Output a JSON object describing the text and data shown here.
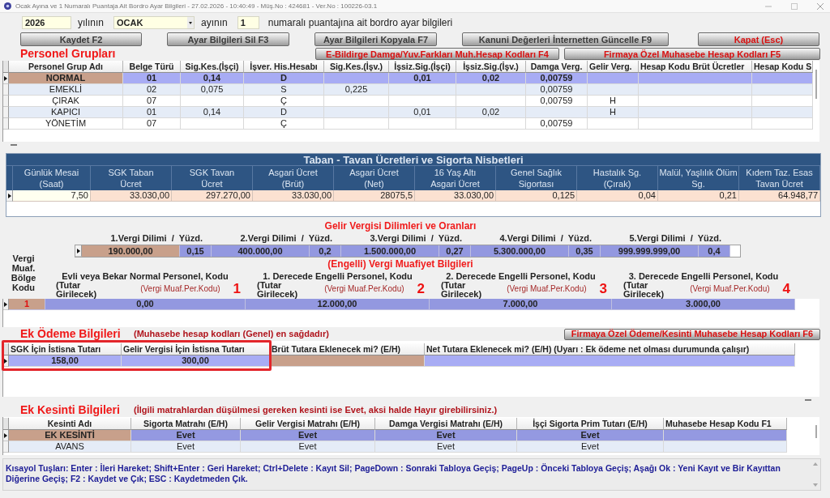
{
  "window": {
    "title": "Ocak Ayına ve 1 Numaralı Puantaja Ait Bordro Ayar Bilgileri - 27.02.2026 - 10:40:49 - Müş.No : 424681 - Ver.No : 100226-03.1"
  },
  "period": {
    "year": "2026",
    "year_label": "yılının",
    "month": "OCAK",
    "month_label": "ayının",
    "payroll_number": "1",
    "caption": "numaralı puantajına ait bordro ayar bilgileri"
  },
  "toolbar": [
    {
      "label": "Kaydet F2",
      "kind": "normal"
    },
    {
      "label": "Ayar Bilgileri Sil F3",
      "kind": "normal"
    },
    {
      "label": "Ayar Bilgileri Kopyala F7",
      "kind": "normal"
    },
    {
      "label": "Kanuni Değerleri İnternetten Güncelle F9",
      "kind": "normal"
    },
    {
      "label": "Kapat (Esc)",
      "kind": "warning"
    }
  ],
  "personel_gruplari": {
    "title": "Personel Grupları",
    "buttons": [
      {
        "label": "E-Bildirge Damga/Yuv.Farkları Muh.Hesap Kodları F4",
        "kind": "warning"
      },
      {
        "label": "Firmaya Özel Muhasebe Hesap Kodları F5",
        "kind": "warning"
      }
    ],
    "columns": [
      {
        "label": "Personel Grup Adı",
        "focused": true
      },
      {
        "label": "Belge Türü",
        "focused": false
      },
      {
        "label": "Sig.Kes.(İşçi)",
        "focused": false
      },
      {
        "label": "İşver. His.Hesabı",
        "focused": false
      },
      {
        "label": "Sig.Kes.(İşv.)",
        "focused": false
      },
      {
        "label": "İşsiz.Sig.(İşçi)",
        "focused": false
      },
      {
        "label": "İşsiz.Sig.(İşv.)",
        "focused": false
      },
      {
        "label": "Damga Verg.",
        "focused": false
      },
      {
        "label": "Gelir Verg.",
        "focused": false
      },
      {
        "label": "Hesap Kodu Brüt Ücretler",
        "focused": false
      },
      {
        "label": "Hesap Kodu S",
        "focused": false
      }
    ],
    "rows": [
      {
        "selected": true,
        "cells": [
          "NORMAL",
          "01",
          "0,14",
          "D",
          null,
          "0,01",
          "0,02",
          "0,00759",
          null,
          null,
          null
        ]
      },
      {
        "selected": false,
        "cells": [
          "EMEKLİ",
          "02",
          "0,075",
          "S",
          "0,225",
          null,
          null,
          "0,00759",
          null,
          null,
          null
        ]
      },
      {
        "selected": false,
        "cells": [
          "ÇIRAK",
          "07",
          null,
          "Ç",
          null,
          null,
          null,
          "0,00759",
          "H",
          null,
          null
        ]
      },
      {
        "selected": false,
        "cells": [
          "KAPICI",
          "01",
          "0,14",
          "D",
          null,
          "0,01",
          "0,02",
          null,
          "H",
          null,
          null
        ]
      },
      {
        "selected": false,
        "cells": [
          "YÖNETİM",
          "07",
          null,
          "Ç",
          null,
          null,
          null,
          "0,00759",
          null,
          null,
          null
        ]
      }
    ]
  },
  "taban_tavan": {
    "title": "Taban - Tavan Ücretleri ve Sigorta Nisbetleri",
    "selected": true,
    "columns": [
      {
        "label": "Günlük Mesai\n(Saat)",
        "value": "7,50",
        "focused": true
      },
      {
        "label": "SGK Taban\nÜcret",
        "value": "33.030,00",
        "focused": false
      },
      {
        "label": "SGK Tavan\nÜcret",
        "value": "297.270,00",
        "focused": false
      },
      {
        "label": "Asgari Ücret\n(Brüt)",
        "value": "33.030,00",
        "focused": false
      },
      {
        "label": "Asgari Ücret\n(Net)",
        "value": "28075,5",
        "focused": false
      },
      {
        "label": "16 Yaş Altı\nAsgari Ücret",
        "value": "33.030,00",
        "focused": false
      },
      {
        "label": "Genel Sağlık\nSigortası",
        "value": "0,125",
        "focused": false
      },
      {
        "label": "Hastalık Sg.\n(Çırak)",
        "value": "0,04",
        "focused": false
      },
      {
        "label": "Malül, Yaşlılık Ölüm\nSg.",
        "value": "0,21",
        "focused": false
      },
      {
        "label": "Kıdem Taz. Esas\nTavan Ücret",
        "value": "64.948,77",
        "focused": false
      }
    ]
  },
  "vergi_dilimleri": {
    "title": "Gelir Vergisi Dilimleri ve Oranları",
    "selected": true,
    "brackets": [
      {
        "label": "1.Vergi Dilimi  /  Yüzd.",
        "limit": "190.000,00",
        "rate": "0,15",
        "focused": true
      },
      {
        "label": "2.Vergi Dilimi  /  Yüzd.",
        "limit": "400.000,00",
        "rate": "0,2",
        "focused": false
      },
      {
        "label": "3.Vergi Dilimi  /  Yüzd.",
        "limit": "1.500.000,00",
        "rate": "0,27",
        "focused": false
      },
      {
        "label": "4.Vergi Dilimi  /  Yüzd.",
        "limit": "5.300.000,00",
        "rate": "0,35",
        "focused": false
      },
      {
        "label": "5.Vergi Dilimi  /  Yüzd.",
        "limit": "999.999.999,00",
        "rate": "0,4",
        "focused": false
      }
    ]
  },
  "vergi_muafiyet": {
    "title": "(Engelli) Vergi Muafiyet Bilgileri",
    "selected": true,
    "region": {
      "label": "Vergi Muaf. Bölge Kodu",
      "value": "1",
      "focused": true
    },
    "groups": [
      {
        "heading": "Evli veya Bekar Normal Personel, Kodu",
        "amount_hint": "(Tutar Girilecek)",
        "code_hint": "(Vergi Muaf.Per.Kodu)",
        "code": "1",
        "value": "0,00",
        "focused": false
      },
      {
        "heading": "1. Derecede Engelli Personel, Kodu",
        "amount_hint": "(Tutar Girilecek)",
        "code_hint": "(Vergi Muaf.Per.Kodu)",
        "code": "2",
        "value": "12.000,00",
        "focused": false
      },
      {
        "heading": "2. Derecede Engelli Personel, Kodu",
        "amount_hint": "(Tutar Girilecek)",
        "code_hint": "(Vergi Muaf.Per.Kodu)",
        "code": "3",
        "value": "7.000,00",
        "focused": false
      },
      {
        "heading": "3. Derecede Engelli Personel, Kodu",
        "amount_hint": "(Tutar Girilecek)",
        "code_hint": "(Vergi Muaf.Per.Kodu)",
        "code": "4",
        "value": "3.000,00",
        "focused": false
      }
    ]
  },
  "ek_odeme": {
    "title": "Ek Ödeme Bilgileri",
    "note": "(Muhasebe hesap kodları (Genel) en sağdadır)",
    "button": {
      "label": "Firmaya Özel Ödeme/Kesinti Muhasebe Hesap Kodları F6",
      "kind": "warning"
    },
    "columns": [
      {
        "label": "SGK İçin İstisna Tutarı",
        "focused": false,
        "highlighted": true
      },
      {
        "label": "Gelir Vergisi İçin İstisna Tutarı",
        "focused": false,
        "highlighted": true
      },
      {
        "label": "Brüt Tutara Eklenecek mi? (E/H)",
        "focused": true,
        "highlighted": false
      },
      {
        "label": "Net Tutara Eklenecek mi? (E/H) (Uyarı : Ek ödeme net olması durumunda çalışır)",
        "focused": false,
        "highlighted": false
      }
    ],
    "rows": [
      {
        "selected": true,
        "cells": [
          "158,00",
          "300,00",
          null,
          null
        ]
      }
    ]
  },
  "ek_kesinti": {
    "title": "Ek Kesinti Bilgileri",
    "note": "(İlgili matrahlardan düşülmesi gereken kesinti ise Evet, aksi halde Hayır girebilirsiniz.)",
    "columns": [
      {
        "label": "Kesinti Adı",
        "focused": true
      },
      {
        "label": "Sigorta Matrahı (E/H)",
        "focused": false
      },
      {
        "label": "Gelir Vergisi Matrahı (E/H)",
        "focused": false
      },
      {
        "label": "Damga Vergisi Matrahı (E/H)",
        "focused": false
      },
      {
        "label": "İşçi Sigorta Prim Tutarı (E/H)",
        "focused": false
      },
      {
        "label": "Muhasebe Hesap Kodu F1",
        "focused": false
      }
    ],
    "rows": [
      {
        "selected": true,
        "cells": [
          "EK KESİNTİ",
          "Evet",
          "Evet",
          "Evet",
          "Evet",
          null
        ]
      },
      {
        "selected": false,
        "cells": [
          "AVANS",
          "Evet",
          "Evet",
          "Evet",
          "Evet",
          null
        ]
      }
    ]
  },
  "shortcuts": "Kısayol Tuşları: Enter : İleri Hareket; Shift+Enter : Geri Hareket; Ctrl+Delete : Kayıt Sil; PageDown : Sonraki Tabloya Geçiş; PageUp : Önceki Tabloya Geçiş; Aşağı Ok : Yeni Kayıt ve Bir Kayıttan Diğerine Geçiş; F2 : Kaydet ve Çık; ESC : Kaydetmeden Çık."
}
